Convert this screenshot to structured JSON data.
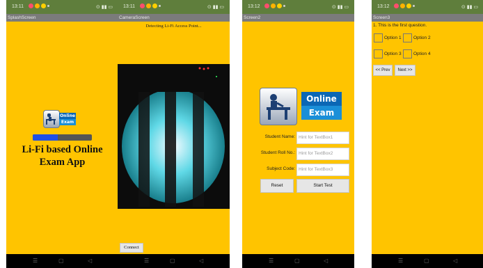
{
  "splash": {
    "time": "13:11",
    "title_bar": "SplashScreen",
    "logo_top": "Online",
    "logo_bottom": "Exam",
    "progress": 0.42,
    "app_title_line1": "Li-Fi based Online",
    "app_title_line2": "Exam App"
  },
  "camera": {
    "time": "13:11",
    "title_bar": "CameraScreen",
    "detecting": "Detecting Li-Fi Access Point...",
    "connect": "Connect"
  },
  "screen2": {
    "time": "13:12",
    "title_bar": "Screen2",
    "logo_top": "Online",
    "logo_bottom": "Exam",
    "fields": [
      {
        "label": "Student Name:",
        "placeholder": "Hint for TextBox1"
      },
      {
        "label": "Student Roll No.:",
        "placeholder": "Hint for TextBox2"
      },
      {
        "label": "Subject Code:",
        "placeholder": "Hint for TextBox3"
      }
    ],
    "reset": "Reset",
    "start": "Start Test"
  },
  "screen3": {
    "time": "13:12",
    "title_bar": "Screen3",
    "question": "1. This is the first question.",
    "options": [
      "Option 1",
      "Option 2",
      "Option 3",
      "Option 4"
    ],
    "prev": "<< Prev",
    "next": "Next >>"
  },
  "status_icons": [
    "notification-icon",
    "app-icon",
    "smiley-icon",
    "dot-icon"
  ],
  "colors": {
    "screen_bg": "#ffc400",
    "status_bar": "#5f7e3c",
    "title_bar": "#7b7b7b",
    "logo_blue": "#0b67b5"
  }
}
